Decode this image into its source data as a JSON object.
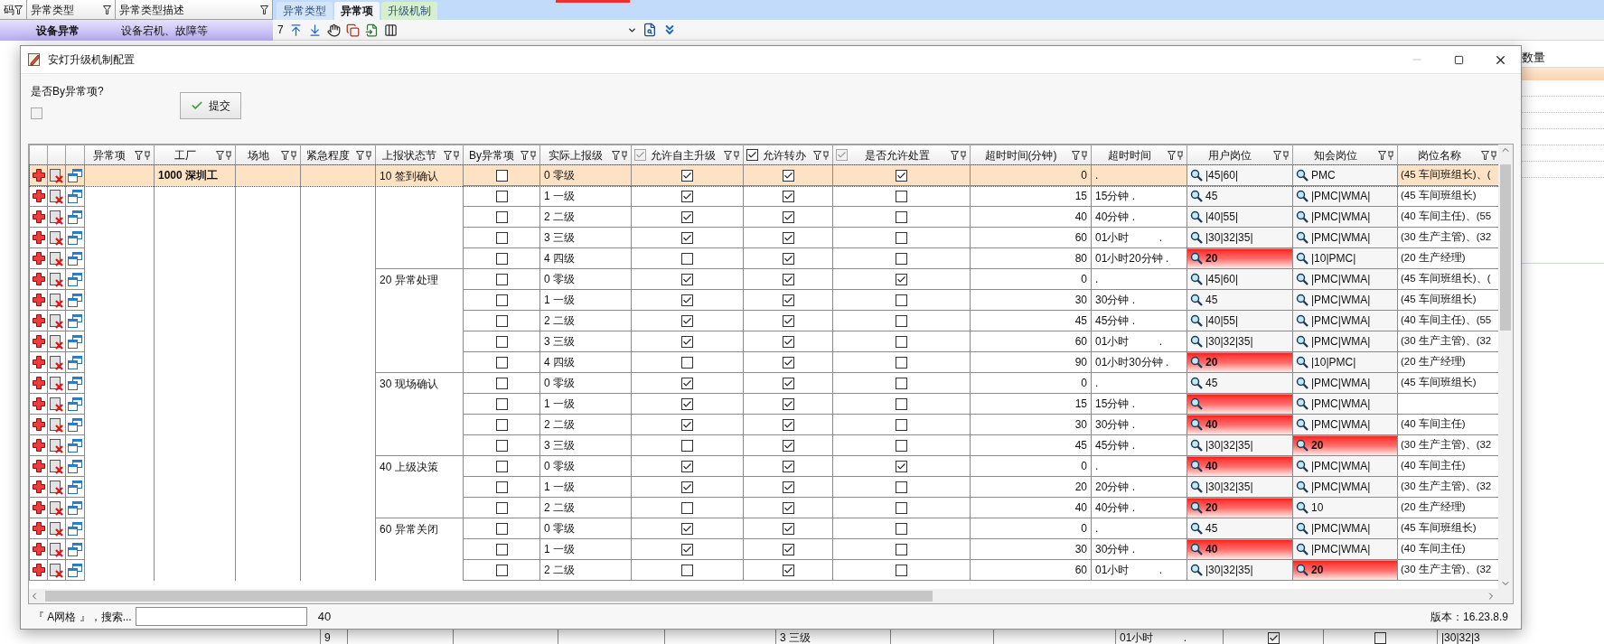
{
  "background": {
    "columns": [
      {
        "label": "码"
      },
      {
        "label": "异常类型"
      },
      {
        "label": "异常类型描述"
      }
    ],
    "row": {
      "type": "设备异常",
      "description": "设备宕机、故障等",
      "selected": true
    },
    "tabs": [
      {
        "label": "异常类型",
        "selected": false,
        "color": "#d4e5f9"
      },
      {
        "label": "异常项",
        "selected": true,
        "color": "#f2f6fc"
      },
      {
        "label": "升级机制",
        "selected": false,
        "color": "#d6f0cf"
      }
    ],
    "toolbar": {
      "page": "7"
    },
    "right_panel": {
      "header": "数量"
    },
    "bottom_row": {
      "number": "9",
      "level": "3 三级",
      "timeout": "01小时          .",
      "check_1": true,
      "check_2": false,
      "post": "|30|32|3"
    }
  },
  "dialog": {
    "title": "安灯升级机制配置",
    "option_label": "是否By异常项?",
    "option_checked": false,
    "submit": "提交",
    "grid": {
      "columns": [
        {
          "label": "异常项"
        },
        {
          "label": "工厂"
        },
        {
          "label": "场地"
        },
        {
          "label": "紧急程度"
        },
        {
          "label": "上报状态节"
        },
        {
          "label": "By异常项"
        },
        {
          "label": "实际上报级"
        },
        {
          "label": "允许自主升级",
          "checkbox": {
            "checked": true,
            "disabled": true
          }
        },
        {
          "label": "允许转办",
          "checkbox": {
            "checked": true,
            "disabled": false
          }
        },
        {
          "label": "是否允许处置",
          "checkbox": {
            "checked": true,
            "disabled": true
          }
        },
        {
          "label": "超时时间(分钟)"
        },
        {
          "label": "超时时间"
        },
        {
          "label": "用户岗位"
        },
        {
          "label": "知会岗位"
        },
        {
          "label": "岗位名称"
        }
      ],
      "factory": "1000 深圳工",
      "groups": [
        {
          "stage": "10 签到确认",
          "rows": [
            {
              "selected": true,
              "by_item": false,
              "level": "0 零级",
              "auto_upgrade": true,
              "transfer": true,
              "dispose": true,
              "timeout_min": "0",
              "timeout": ".",
              "user_post": {
                "text": "|45|60|",
                "alert": false
              },
              "notify_post": {
                "text": "PMC",
                "alert": false
              },
              "post_name": "(45 车间班组长)、("
            },
            {
              "selected": false,
              "by_item": false,
              "level": "1 一级",
              "auto_upgrade": true,
              "transfer": true,
              "dispose": false,
              "timeout_min": "15",
              "timeout": "15分钟 .",
              "user_post": {
                "text": "45",
                "alert": false
              },
              "notify_post": {
                "text": "|PMC|WMA|",
                "alert": false
              },
              "post_name": "(45 车间班组长)"
            },
            {
              "selected": false,
              "by_item": false,
              "level": "2 二级",
              "auto_upgrade": true,
              "transfer": true,
              "dispose": false,
              "timeout_min": "40",
              "timeout": "40分钟 .",
              "user_post": {
                "text": "|40|55|",
                "alert": false
              },
              "notify_post": {
                "text": "|PMC|WMA|",
                "alert": false
              },
              "post_name": "(40 车间主任)、(55"
            },
            {
              "selected": false,
              "by_item": false,
              "level": "3 三级",
              "auto_upgrade": true,
              "transfer": true,
              "dispose": false,
              "timeout_min": "60",
              "timeout": "01小时          .",
              "user_post": {
                "text": "|30|32|35|",
                "alert": false
              },
              "notify_post": {
                "text": "|PMC|WMA|",
                "alert": false
              },
              "post_name": "(30 生产主管)、(32"
            },
            {
              "selected": false,
              "by_item": false,
              "level": "4 四级",
              "auto_upgrade": false,
              "transfer": true,
              "dispose": false,
              "timeout_min": "80",
              "timeout": "01小时20分钟 .",
              "user_post": {
                "text": "20",
                "alert": true
              },
              "notify_post": {
                "text": "|10|PMC|",
                "alert": false
              },
              "post_name": "(20 生产经理)"
            }
          ]
        },
        {
          "stage": "20 异常处理",
          "rows": [
            {
              "selected": false,
              "by_item": false,
              "level": "0 零级",
              "auto_upgrade": true,
              "transfer": true,
              "dispose": true,
              "timeout_min": "0",
              "timeout": ".",
              "user_post": {
                "text": "|45|60|",
                "alert": false
              },
              "notify_post": {
                "text": "|PMC|WMA|",
                "alert": false
              },
              "post_name": "(45 车间班组长)、("
            },
            {
              "selected": false,
              "by_item": false,
              "level": "1 一级",
              "auto_upgrade": true,
              "transfer": true,
              "dispose": false,
              "timeout_min": "30",
              "timeout": "30分钟 .",
              "user_post": {
                "text": "45",
                "alert": false
              },
              "notify_post": {
                "text": "|PMC|WMA|",
                "alert": false
              },
              "post_name": "(45 车间班组长)"
            },
            {
              "selected": false,
              "by_item": false,
              "level": "2 二级",
              "auto_upgrade": true,
              "transfer": true,
              "dispose": false,
              "timeout_min": "45",
              "timeout": "45分钟 .",
              "user_post": {
                "text": "|40|55|",
                "alert": false
              },
              "notify_post": {
                "text": "|PMC|WMA|",
                "alert": false
              },
              "post_name": "(40 车间主任)、(55"
            },
            {
              "selected": false,
              "by_item": false,
              "level": "3 三级",
              "auto_upgrade": true,
              "transfer": true,
              "dispose": false,
              "timeout_min": "60",
              "timeout": "01小时          .",
              "user_post": {
                "text": "|30|32|35|",
                "alert": false
              },
              "notify_post": {
                "text": "|PMC|WMA|",
                "alert": false
              },
              "post_name": "(30 生产主管)、(32"
            },
            {
              "selected": false,
              "by_item": false,
              "level": "4 四级",
              "auto_upgrade": false,
              "transfer": true,
              "dispose": false,
              "timeout_min": "90",
              "timeout": "01小时30分钟 .",
              "user_post": {
                "text": "20",
                "alert": true
              },
              "notify_post": {
                "text": "|10|PMC|",
                "alert": false
              },
              "post_name": "(20 生产经理)"
            }
          ]
        },
        {
          "stage": "30 现场确认",
          "rows": [
            {
              "selected": false,
              "by_item": false,
              "level": "0 零级",
              "auto_upgrade": true,
              "transfer": true,
              "dispose": false,
              "timeout_min": "0",
              "timeout": ".",
              "user_post": {
                "text": "45",
                "alert": false
              },
              "notify_post": {
                "text": "|PMC|WMA|",
                "alert": false
              },
              "post_name": "(45 车间班组长)"
            },
            {
              "selected": false,
              "by_item": false,
              "level": "1 一级",
              "auto_upgrade": true,
              "transfer": true,
              "dispose": false,
              "timeout_min": "15",
              "timeout": "15分钟 .",
              "user_post": {
                "alert": true
              },
              "notify_post": {
                "text": "|PMC|WMA|",
                "alert": false
              }
            },
            {
              "selected": false,
              "by_item": false,
              "level": "2 二级",
              "auto_upgrade": true,
              "transfer": true,
              "dispose": false,
              "timeout_min": "30",
              "timeout": "30分钟 .",
              "user_post": {
                "text": "40",
                "alert": true
              },
              "notify_post": {
                "text": "|PMC|WMA|",
                "alert": false
              },
              "post_name": "(40 车间主任)"
            },
            {
              "selected": false,
              "by_item": false,
              "level": "3 三级",
              "auto_upgrade": false,
              "transfer": true,
              "dispose": false,
              "timeout_min": "45",
              "timeout": "45分钟 .",
              "user_post": {
                "text": "|30|32|35|",
                "alert": false
              },
              "notify_post": {
                "text": "20",
                "alert": true
              },
              "post_name": "(30 生产主管)、(32"
            }
          ]
        },
        {
          "stage": "40 上级决策",
          "rows": [
            {
              "selected": false,
              "by_item": false,
              "level": "0 零级",
              "auto_upgrade": true,
              "transfer": true,
              "dispose": true,
              "timeout_min": "0",
              "timeout": ".",
              "user_post": {
                "text": "40",
                "alert": true
              },
              "notify_post": {
                "text": "|PMC|WMA|",
                "alert": false
              },
              "post_name": "(40 车间主任)"
            },
            {
              "selected": false,
              "by_item": false,
              "level": "1 一级",
              "auto_upgrade": true,
              "transfer": true,
              "dispose": false,
              "timeout_min": "20",
              "timeout": "20分钟 .",
              "user_post": {
                "text": "|30|32|35|",
                "alert": false
              },
              "notify_post": {
                "text": "|PMC|WMA|",
                "alert": false
              },
              "post_name": "(30 生产主管)、(32"
            },
            {
              "selected": false,
              "by_item": false,
              "level": "2 二级",
              "auto_upgrade": false,
              "transfer": true,
              "dispose": false,
              "timeout_min": "40",
              "timeout": "40分钟 .",
              "user_post": {
                "text": "20",
                "alert": true
              },
              "notify_post": {
                "text": "10",
                "alert": false
              },
              "post_name": "(20 生产经理)"
            }
          ]
        },
        {
          "stage": "60 异常关闭",
          "rows": [
            {
              "selected": false,
              "by_item": false,
              "level": "0 零级",
              "auto_upgrade": true,
              "transfer": true,
              "dispose": false,
              "timeout_min": "0",
              "timeout": ".",
              "user_post": {
                "text": "45",
                "alert": false
              },
              "notify_post": {
                "text": "|PMC|WMA|",
                "alert": false
              },
              "post_name": "(45 车间班组长)"
            },
            {
              "selected": false,
              "by_item": false,
              "level": "1 一级",
              "auto_upgrade": true,
              "transfer": true,
              "dispose": false,
              "timeout_min": "30",
              "timeout": "30分钟 .",
              "user_post": {
                "text": "40",
                "alert": true
              },
              "notify_post": {
                "text": "|PMC|WMA|",
                "alert": false
              },
              "post_name": "(40 车间主任)"
            },
            {
              "selected": false,
              "by_item": false,
              "level": "2 二级",
              "auto_upgrade": false,
              "transfer": true,
              "dispose": false,
              "timeout_min": "60",
              "timeout": "01小时          .",
              "user_post": {
                "text": "|30|32|35|",
                "alert": false
              },
              "notify_post": {
                "text": "20",
                "alert": true
              },
              "post_name": "(30 生产主管)、(32"
            }
          ]
        }
      ]
    },
    "status": {
      "grid_label": "『 A网格 』，搜索...",
      "count": "40",
      "version": "版本：16.23.8.9"
    }
  }
}
